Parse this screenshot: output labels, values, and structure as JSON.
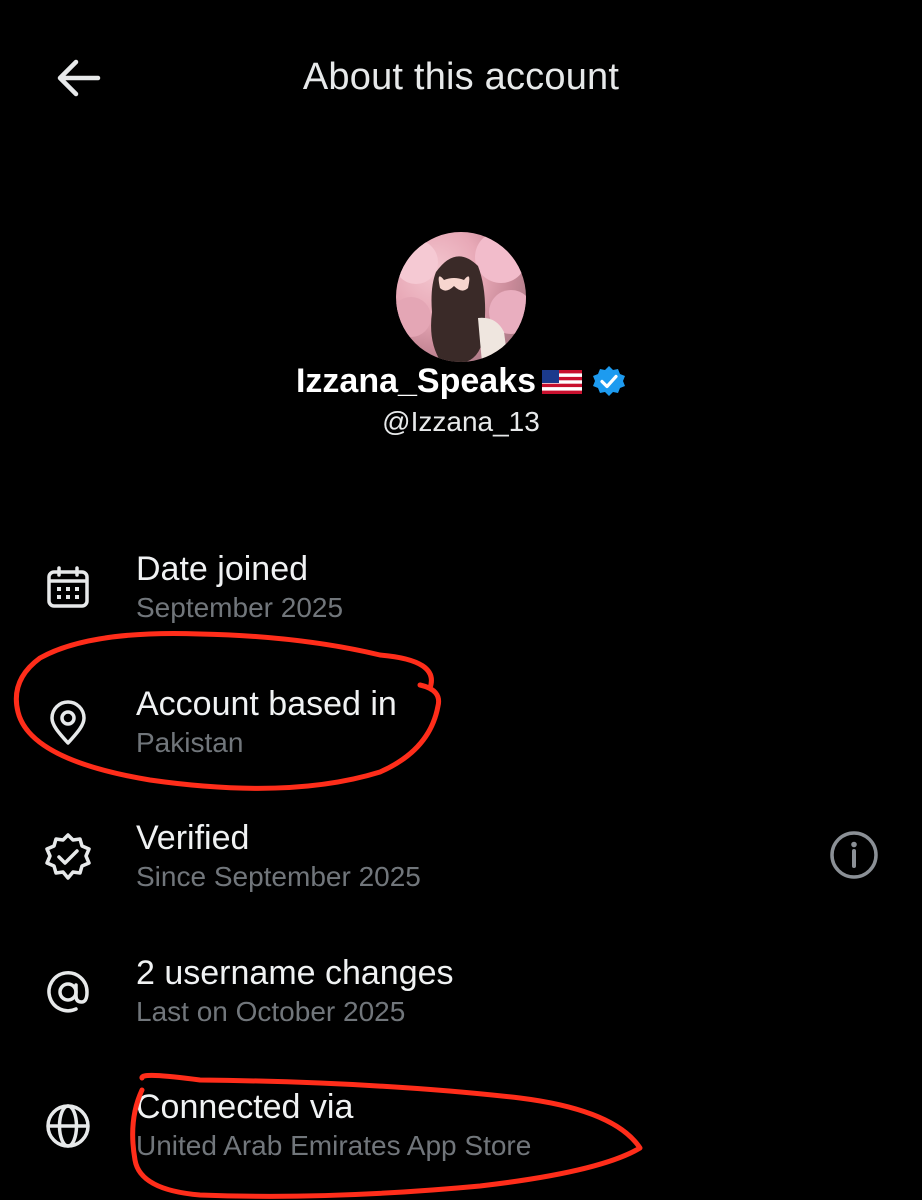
{
  "header": {
    "title": "About this account"
  },
  "profile": {
    "display_name": "Izzana_Speaks",
    "handle": "@Izzana_13"
  },
  "details": [
    {
      "label": "Date joined",
      "value": "September 2025"
    },
    {
      "label": "Account based in",
      "value": "Pakistan"
    },
    {
      "label": "Verified",
      "value": "Since September 2025"
    },
    {
      "label": "2 username changes",
      "value": "Last on October 2025"
    },
    {
      "label": "Connected via",
      "value": "United Arab Emirates App Store"
    }
  ],
  "icons": {
    "back": "arrow-left-icon",
    "calendar": "calendar-icon",
    "location": "location-pin-icon",
    "verified": "verified-badge-icon",
    "at": "at-sign-icon",
    "globe": "globe-icon",
    "info": "info-icon",
    "flag": "us-flag-icon"
  },
  "colors": {
    "background": "#000000",
    "primary_text": "#e7e9ea",
    "secondary_text": "#71767b",
    "verified_blue": "#1d9bf0",
    "annotation_red": "#ff2d1a"
  }
}
